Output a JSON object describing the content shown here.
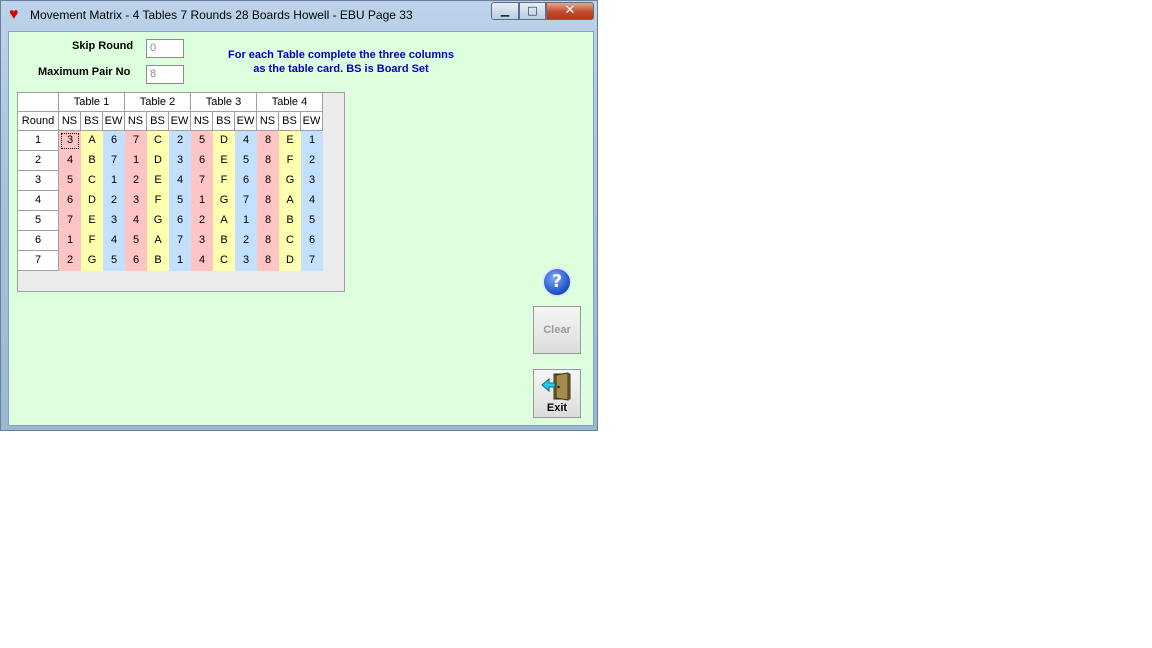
{
  "window": {
    "title": "Movement Matrix -  4 Tables  7 Rounds 28 Boards  Howell - EBU Page 33",
    "minimize_label": "▁",
    "maximize_label": "□",
    "close_label": "✕"
  },
  "form": {
    "skip_round_label": "Skip Round",
    "skip_round_value": "0",
    "max_pair_label": "Maximum Pair No",
    "max_pair_value": "8",
    "note_line1": "For each Table complete the three columns",
    "note_line2": "as the table card. BS is Board Set"
  },
  "matrix": {
    "corner": "",
    "round_header": "Round",
    "tables": [
      "Table 1",
      "Table 2",
      "Table 3",
      "Table 4"
    ],
    "subcolumns": [
      "NS",
      "BS",
      "EW"
    ],
    "column_colors": {
      "NS": "#ffc4c4",
      "BS": "#ffffb0",
      "EW": "#c4e0ff"
    },
    "rows": [
      {
        "round": "1",
        "cells": [
          "3",
          "A",
          "6",
          "7",
          "C",
          "2",
          "5",
          "D",
          "4",
          "8",
          "E",
          "1"
        ]
      },
      {
        "round": "2",
        "cells": [
          "4",
          "B",
          "7",
          "1",
          "D",
          "3",
          "6",
          "E",
          "5",
          "8",
          "F",
          "2"
        ]
      },
      {
        "round": "3",
        "cells": [
          "5",
          "C",
          "1",
          "2",
          "E",
          "4",
          "7",
          "F",
          "6",
          "8",
          "G",
          "3"
        ]
      },
      {
        "round": "4",
        "cells": [
          "6",
          "D",
          "2",
          "3",
          "F",
          "5",
          "1",
          "G",
          "7",
          "8",
          "A",
          "4"
        ]
      },
      {
        "round": "5",
        "cells": [
          "7",
          "E",
          "3",
          "4",
          "G",
          "6",
          "2",
          "A",
          "1",
          "8",
          "B",
          "5"
        ]
      },
      {
        "round": "6",
        "cells": [
          "1",
          "F",
          "4",
          "5",
          "A",
          "7",
          "3",
          "B",
          "2",
          "8",
          "C",
          "6"
        ]
      },
      {
        "round": "7",
        "cells": [
          "2",
          "G",
          "5",
          "6",
          "B",
          "1",
          "4",
          "C",
          "3",
          "8",
          "D",
          "7"
        ]
      }
    ]
  },
  "buttons": {
    "help_label": "?",
    "clear_label": "Clear",
    "exit_label": "Exit"
  },
  "icons": {
    "app": "heart-icon",
    "help": "help-icon",
    "exit": "exit-door-icon"
  }
}
